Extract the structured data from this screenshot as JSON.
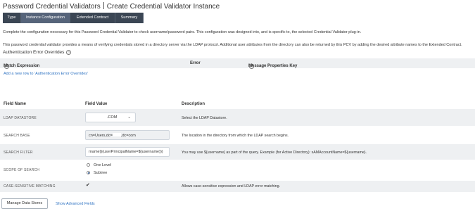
{
  "breadcrumb": {
    "parent": "Password Credential Validators",
    "current": "Create Credential Validator Instance"
  },
  "tabs": [
    {
      "label": "Type",
      "active": false
    },
    {
      "label": "Instance Configuration",
      "active": true
    },
    {
      "label": "Extended Contract",
      "active": false
    },
    {
      "label": "Summary",
      "active": false
    }
  ],
  "intro": {
    "line1": "Complete the configuration necessary for this Password Credential Validator to check username/password pairs. This configuration was designed into, and is specific to, the selected Credential Validator plug-in.",
    "line2": "This password credential validator provides a means of verifying credentials stored in a directory server via the LDAP protocol. Additional user attributes from the directory can also be returned by this PCV by adding the desired attribute names to the Extended Contract."
  },
  "overrides": {
    "title": "Authentication Error Overrides",
    "col_match": "Match Expression",
    "col_error": "Error",
    "col_message": "Message Properties Key",
    "add_link": "Add a new row to 'Authentication Error Overrides'"
  },
  "fields_header": {
    "name": "Field Name",
    "value": "Field Value",
    "description": "Description"
  },
  "fields": {
    "ldap_datastore": {
      "label": "LDAP DATASTORE",
      "value": ".COM",
      "description": "Select the LDAP Datastore."
    },
    "search_base": {
      "label": "SEARCH BASE",
      "value_prefix": "cn=Users,dc=",
      "value_suffix": ",dc=com",
      "description": "The location in the directory from which the LDAP search begins."
    },
    "search_filter": {
      "label": "SEARCH FILTER",
      "value": "rname})(userPrincipalName=${username}))",
      "description": "You may use ${username} as part of the query. Example (for Active Directory): sAMAccountName=${username}."
    },
    "scope": {
      "label": "SCOPE OF SEARCH",
      "options": [
        "One Level",
        "Subtree"
      ],
      "selected": "Subtree"
    },
    "case_sensitive": {
      "label": "CASE-SENSITIVE MATCHING",
      "checked": true,
      "description": "Allows case-sensitive expression and LDAP error matching."
    }
  },
  "actions": {
    "manage_label": "Manage Data Stores",
    "advanced_label": "Show Advanced Fields"
  },
  "colors": {
    "tab_bg": "#3b4654",
    "tab_active": "#56647a",
    "link": "#2f73c2",
    "row_shade": "#eef0f2"
  }
}
